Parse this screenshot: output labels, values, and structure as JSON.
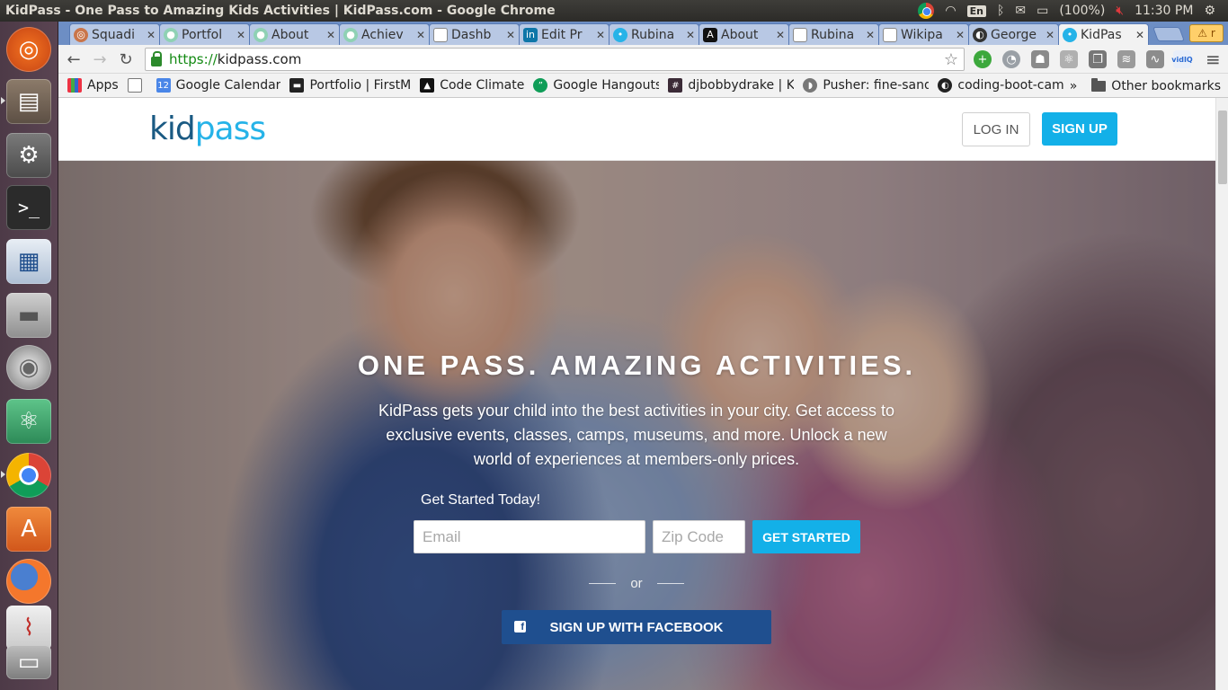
{
  "system": {
    "window_title": "KidPass - One Pass to Amazing Kids Activities | KidPass.com - Google Chrome",
    "keyboard": "En",
    "battery": "(100%)",
    "clock": "11:30 PM"
  },
  "launcher": {
    "items": [
      "ubuntu-dash",
      "files",
      "system-settings",
      "terminal",
      "libreoffice-writer",
      "disk",
      "dvd",
      "atom",
      "chrome",
      "software-center",
      "firefox",
      "document-viewer",
      "drive"
    ]
  },
  "browser": {
    "tabs": [
      {
        "label": "Squadi",
        "icon": "squad-icon"
      },
      {
        "label": "Portfol",
        "icon": "portfolio-icon"
      },
      {
        "label": "About",
        "icon": "about-icon"
      },
      {
        "label": "Achiev",
        "icon": "achieve-icon"
      },
      {
        "label": "Dashb",
        "icon": "page-icon"
      },
      {
        "label": "Edit Pr",
        "icon": "linkedin-icon"
      },
      {
        "label": "Rubina",
        "icon": "pin-icon"
      },
      {
        "label": "About",
        "icon": "about-dark-icon"
      },
      {
        "label": "Rubina",
        "icon": "page-icon"
      },
      {
        "label": "Wikipa",
        "icon": "page-icon"
      },
      {
        "label": "George",
        "icon": "github-icon"
      },
      {
        "label": "KidPas",
        "icon": "kidpass-icon"
      }
    ],
    "warning_label": "r",
    "url_scheme": "https://",
    "url_host": "kidpass.com",
    "bookmarks": [
      {
        "label": "Apps",
        "icon": "apps-grid-icon"
      },
      {
        "label": "",
        "icon": "page-icon"
      },
      {
        "label": "Google Calendar",
        "icon": "calendar-icon",
        "badge": "12"
      },
      {
        "label": "Portfolio | FirstM",
        "icon": "firstm-icon"
      },
      {
        "label": "Code Climate",
        "icon": "codeclimate-icon"
      },
      {
        "label": "Google Hangouts",
        "icon": "hangouts-icon"
      },
      {
        "label": "djbobbydrake | Ki",
        "icon": "hash-icon"
      },
      {
        "label": "Pusher: fine-sand",
        "icon": "pusher-icon"
      },
      {
        "label": "coding-boot-cam",
        "icon": "github-icon"
      }
    ],
    "bookmarks_overflow": "»",
    "other_bookmarks": "Other bookmarks"
  },
  "site": {
    "logo_kid": "kid",
    "logo_pass": "pass",
    "login_label": "LOG IN",
    "signup_label": "SIGN UP",
    "hero_title": "ONE PASS. AMAZING ACTIVITIES.",
    "hero_description": "KidPass gets your child into the best activities in your city. Get access to exclusive events, classes, camps, museums, and more. Unlock a new world of experiences at members-only prices.",
    "get_started_today": "Get Started Today!",
    "email_placeholder": "Email",
    "zip_placeholder": "Zip Code",
    "get_started_button": "GET STARTED",
    "or_label": "or",
    "facebook_button": "SIGN UP WITH FACEBOOK"
  },
  "colors": {
    "brand_dark": "#1a5a83",
    "brand_light": "#26b3e8",
    "accent": "#13b0e8",
    "facebook": "#1f4f8f"
  }
}
